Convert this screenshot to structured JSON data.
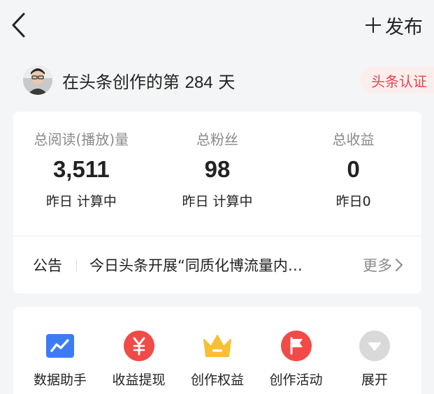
{
  "header": {
    "publish_label": "发布"
  },
  "creator": {
    "days_prefix": "在头条创作的第 ",
    "days_count": "284",
    "days_suffix": " 天",
    "cert_label": "头条认证"
  },
  "stats": [
    {
      "label": "总阅读(播放)量",
      "value": "3,511",
      "sub": "昨日 计算中"
    },
    {
      "label": "总粉丝",
      "value": "98",
      "sub": "昨日 计算中"
    },
    {
      "label": "总收益",
      "value": "0",
      "sub": "昨日0"
    }
  ],
  "notice": {
    "tag": "公告",
    "text": "今日头条开展“同质化博流量内…",
    "more_label": "更多"
  },
  "tools": [
    {
      "label": "数据助手",
      "icon": "data-chart-icon",
      "color": "#3c7bf4"
    },
    {
      "label": "收益提现",
      "icon": "yen-icon",
      "color": "#f04b47"
    },
    {
      "label": "创作权益",
      "icon": "crown-icon",
      "color": "#f7c034"
    },
    {
      "label": "创作活动",
      "icon": "flag-icon",
      "color": "#f04b47"
    },
    {
      "label": "展开",
      "icon": "expand-icon",
      "color": "#d9d9d9"
    }
  ]
}
